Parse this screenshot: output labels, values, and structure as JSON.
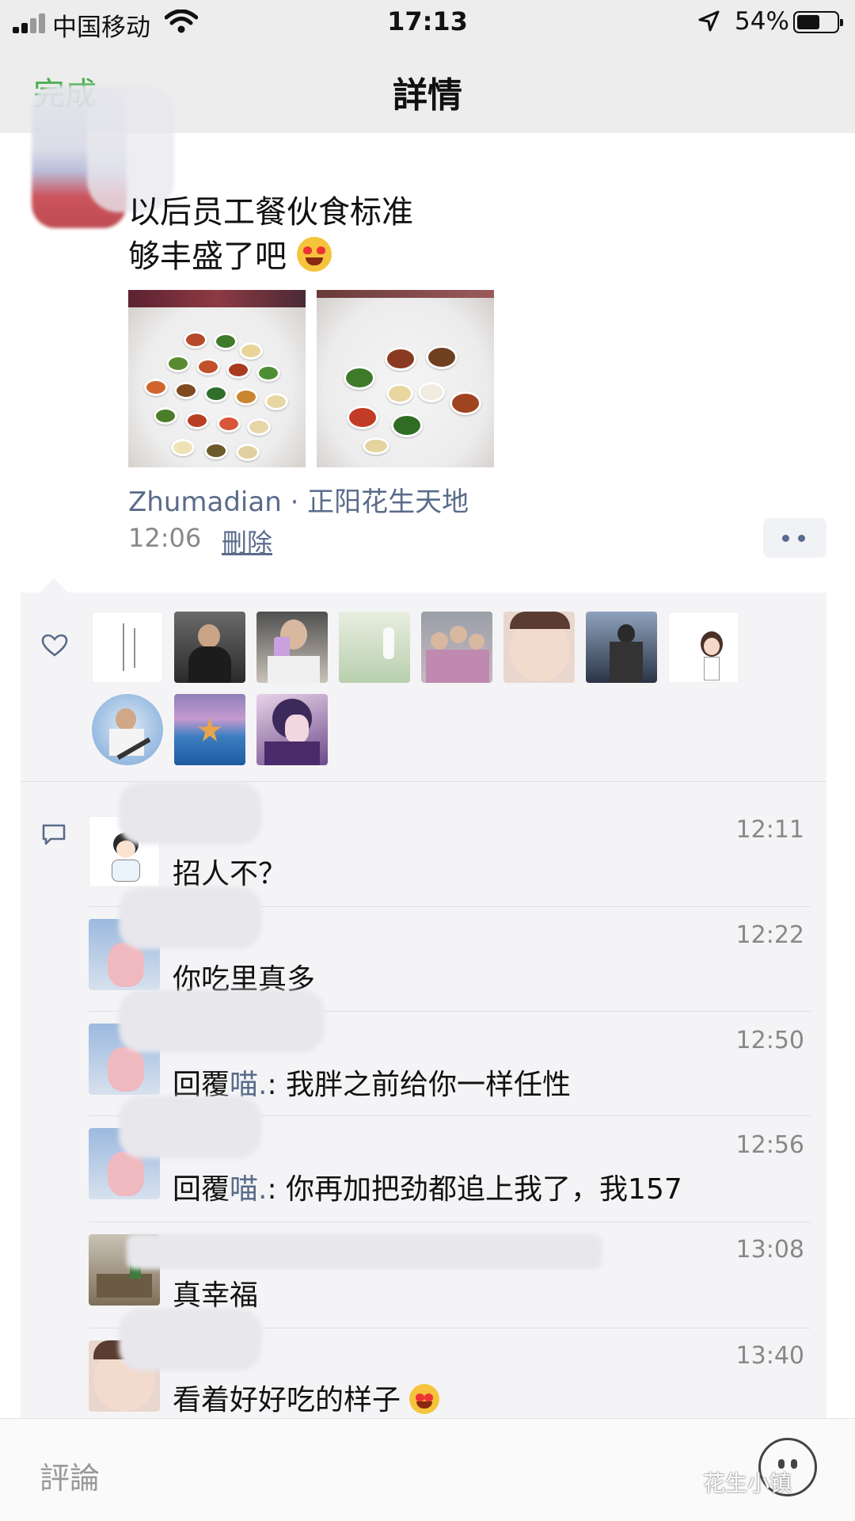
{
  "status_bar": {
    "carrier": "中国移动",
    "time": "17:13",
    "battery_percent": "54%",
    "battery_level": 0.54
  },
  "nav": {
    "done_label": "完成",
    "title": "詳情"
  },
  "post": {
    "text_line1": "以后员工餐伙食标准",
    "text_line2": "够丰盛了吧",
    "emoji": "heart-eyes-emoji",
    "location": "Zhumadian · 正阳花生天地",
    "time": "12:06",
    "delete_label": "刪除",
    "photo_count": 2
  },
  "likes": {
    "icon": "heart-icon",
    "avatar_count": 11
  },
  "comments": [
    {
      "time": "12:11",
      "text": "招人不？"
    },
    {
      "time": "12:22",
      "text": "你吃里真多"
    },
    {
      "time": "12:50",
      "reply_prefix": "回覆",
      "reply_to": "喵.",
      "text": ": 我胖之前给你一样任性"
    },
    {
      "time": "12:56",
      "reply_prefix": "回覆",
      "reply_to": "喵.",
      "text": ": 你再加把劲都追上我了，我157"
    },
    {
      "time": "13:08",
      "text": "真幸福"
    },
    {
      "time": "13:40",
      "text": "看着好好吃的样子"
    }
  ],
  "composer": {
    "placeholder": "評論",
    "watermark": "花生小镇"
  },
  "colors": {
    "link": "#5a6b8a",
    "done": "#4caf50",
    "panel": "#f4f4f6"
  }
}
